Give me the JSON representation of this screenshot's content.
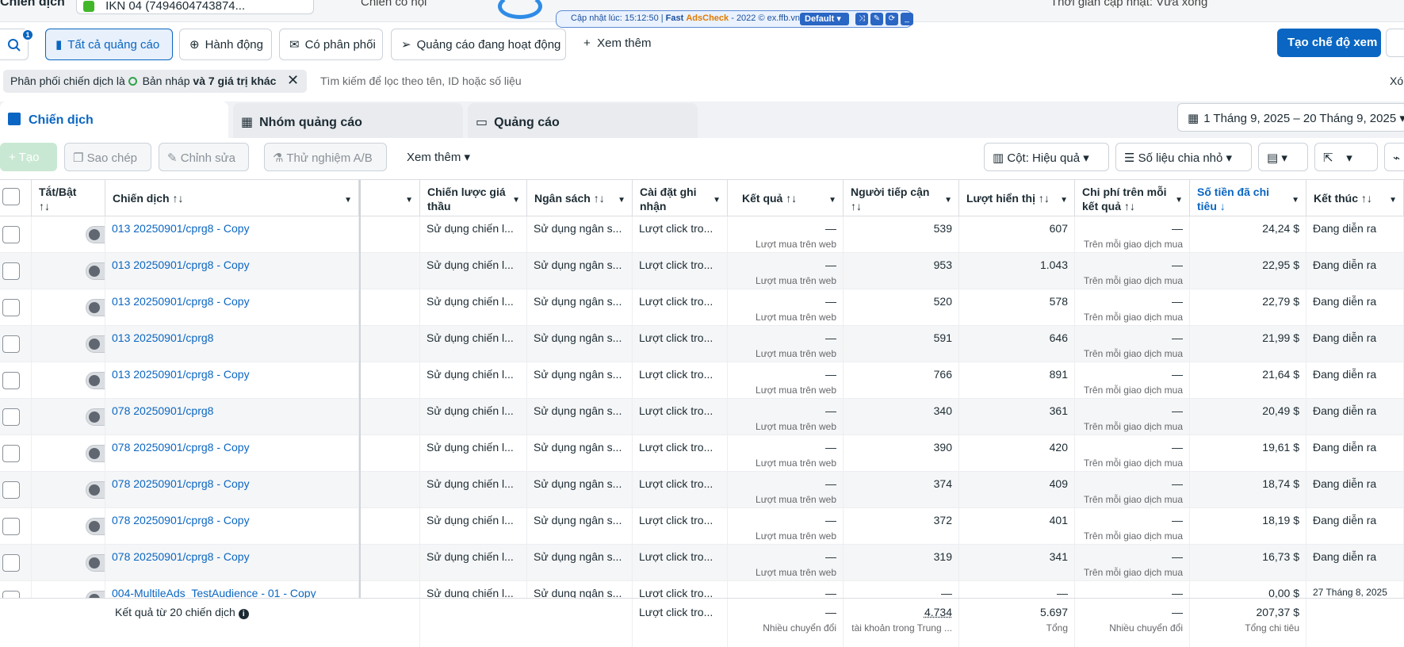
{
  "top": {
    "page_title": "Chiến dịch",
    "account_name": "IKN 04 (7494604743874...",
    "breadcrumb": "Chiến có hội",
    "refresh_text": "Thời gian cập nhật: Vừa xong"
  },
  "extension": {
    "update_label": "Cập nhật lúc: 15:12:50 |",
    "brand_fast": "Fast",
    "brand_ads": "AdsCheck",
    "copyright": "- 2022 © ex.ffb.vn",
    "profile": "Default"
  },
  "toolbar": {
    "notif_count": "1",
    "all_ads": "Tất cả quảng cáo",
    "actions": "Hành động",
    "delivered": "Có phân phối",
    "active_ads": "Quảng cáo đang hoạt động",
    "see_more": "Xem thêm",
    "create_view": "Tạo chế độ xem"
  },
  "filter": {
    "chip_text": "Phân phối chiến dịch là",
    "chip_value": "Bản nháp",
    "chip_more": "và 7 giá trị khác",
    "placeholder": "Tìm kiếm để lọc theo tên, ID hoặc số liệu",
    "clear": "Xó"
  },
  "tabs": {
    "campaigns": "Chiến dịch",
    "adsets": "Nhóm quảng cáo",
    "ads": "Quảng cáo",
    "date_range": "1 Tháng 9, 2025 – 20 Tháng 9, 2025"
  },
  "actions": {
    "create": "Tạo",
    "duplicate": "Sao chép",
    "edit": "Chỉnh sửa",
    "ab_test": "Thử nghiệm A/B",
    "more": "Xem thêm",
    "columns": "Cột: Hiệu quả",
    "breakdown": "Số liệu chia nhỏ"
  },
  "columns": {
    "toggle": "Tắt/Bật",
    "campaign": "Chiến dịch",
    "bid_strategy": "Chiến lược giá thầu",
    "budget": "Ngân sách",
    "attribution": "Cài đặt ghi nhận",
    "results": "Kết quả",
    "reach": "Người tiếp cận",
    "impressions": "Lượt hiển thị",
    "cost_per_result": "Chi phí trên mỗi kết quả",
    "amount_spent": "Số tiền đã chi tiêu",
    "ends": "Kết thúc"
  },
  "rows": [
    {
      "name": "013 20250901/cprg8 - Copy",
      "bid": "Sử dụng chiến l...",
      "budget": "Sử dụng ngân s...",
      "attr": "Lượt click tro...",
      "result": "—",
      "result_sub": "Lượt mua trên web",
      "reach": "539",
      "impr": "607",
      "cpr": "—",
      "cpr_sub": "Trên mỗi giao dịch mua",
      "spent": "24,24 $",
      "end": "Đang diễn ra"
    },
    {
      "name": "013 20250901/cprg8 - Copy",
      "bid": "Sử dụng chiến l...",
      "budget": "Sử dụng ngân s...",
      "attr": "Lượt click tro...",
      "result": "—",
      "result_sub": "Lượt mua trên web",
      "reach": "953",
      "impr": "1.043",
      "cpr": "—",
      "cpr_sub": "Trên mỗi giao dịch mua",
      "spent": "22,95 $",
      "end": "Đang diễn ra"
    },
    {
      "name": "013 20250901/cprg8 - Copy",
      "bid": "Sử dụng chiến l...",
      "budget": "Sử dụng ngân s...",
      "attr": "Lượt click tro...",
      "result": "—",
      "result_sub": "Lượt mua trên web",
      "reach": "520",
      "impr": "578",
      "cpr": "—",
      "cpr_sub": "Trên mỗi giao dịch mua",
      "spent": "22,79 $",
      "end": "Đang diễn ra"
    },
    {
      "name": "013 20250901/cprg8",
      "bid": "Sử dụng chiến l...",
      "budget": "Sử dụng ngân s...",
      "attr": "Lượt click tro...",
      "result": "—",
      "result_sub": "Lượt mua trên web",
      "reach": "591",
      "impr": "646",
      "cpr": "—",
      "cpr_sub": "Trên mỗi giao dịch mua",
      "spent": "21,99 $",
      "end": "Đang diễn ra"
    },
    {
      "name": "013 20250901/cprg8 - Copy",
      "bid": "Sử dụng chiến l...",
      "budget": "Sử dụng ngân s...",
      "attr": "Lượt click tro...",
      "result": "—",
      "result_sub": "Lượt mua trên web",
      "reach": "766",
      "impr": "891",
      "cpr": "—",
      "cpr_sub": "Trên mỗi giao dịch mua",
      "spent": "21,64 $",
      "end": "Đang diễn ra"
    },
    {
      "name": "078 20250901/cprg8",
      "bid": "Sử dụng chiến l...",
      "budget": "Sử dụng ngân s...",
      "attr": "Lượt click tro...",
      "result": "—",
      "result_sub": "Lượt mua trên web",
      "reach": "340",
      "impr": "361",
      "cpr": "—",
      "cpr_sub": "Trên mỗi giao dịch mua",
      "spent": "20,49 $",
      "end": "Đang diễn ra"
    },
    {
      "name": "078 20250901/cprg8 - Copy",
      "bid": "Sử dụng chiến l...",
      "budget": "Sử dụng ngân s...",
      "attr": "Lượt click tro...",
      "result": "—",
      "result_sub": "Lượt mua trên web",
      "reach": "390",
      "impr": "420",
      "cpr": "—",
      "cpr_sub": "Trên mỗi giao dịch mua",
      "spent": "19,61 $",
      "end": "Đang diễn ra"
    },
    {
      "name": "078 20250901/cprg8 - Copy",
      "bid": "Sử dụng chiến l...",
      "budget": "Sử dụng ngân s...",
      "attr": "Lượt click tro...",
      "result": "—",
      "result_sub": "Lượt mua trên web",
      "reach": "374",
      "impr": "409",
      "cpr": "—",
      "cpr_sub": "Trên mỗi giao dịch mua",
      "spent": "18,74 $",
      "end": "Đang diễn ra"
    },
    {
      "name": "078 20250901/cprg8 - Copy",
      "bid": "Sử dụng chiến l...",
      "budget": "Sử dụng ngân s...",
      "attr": "Lượt click tro...",
      "result": "—",
      "result_sub": "Lượt mua trên web",
      "reach": "372",
      "impr": "401",
      "cpr": "—",
      "cpr_sub": "Trên mỗi giao dịch mua",
      "spent": "18,19 $",
      "end": "Đang diễn ra"
    },
    {
      "name": "078 20250901/cprg8 - Copy",
      "bid": "Sử dụng chiến l...",
      "budget": "Sử dụng ngân s...",
      "attr": "Lượt click tro...",
      "result": "—",
      "result_sub": "Lượt mua trên web",
      "reach": "319",
      "impr": "341",
      "cpr": "—",
      "cpr_sub": "Trên mỗi giao dịch mua",
      "spent": "16,73 $",
      "end": "Đang diễn ra"
    },
    {
      "name": "004-MultileAds_TestAudience - 01 - Copy",
      "bid": "Sử dụng chiến l...",
      "budget": "Sử dụng ngân s...",
      "attr": "Lượt click tro...",
      "result": "—",
      "result_sub": "",
      "reach": "—",
      "impr": "—",
      "cpr": "—",
      "cpr_sub": "",
      "spent": "0,00 $",
      "end": "27 Tháng 8, 2025"
    }
  ],
  "footer": {
    "label": "Kết quả từ 20 chiến dịch",
    "attr": "Lượt click tro...",
    "result": "—",
    "result_sub": "Nhiều chuyển đổi",
    "reach": "4.734",
    "reach_sub": "tài khoản trong Trung ...",
    "impr": "5.697",
    "impr_sub": "Tổng",
    "cpr": "—",
    "cpr_sub": "Nhiều chuyển đổi",
    "spent": "207,37 $",
    "spent_sub": "Tổng chi tiêu"
  }
}
